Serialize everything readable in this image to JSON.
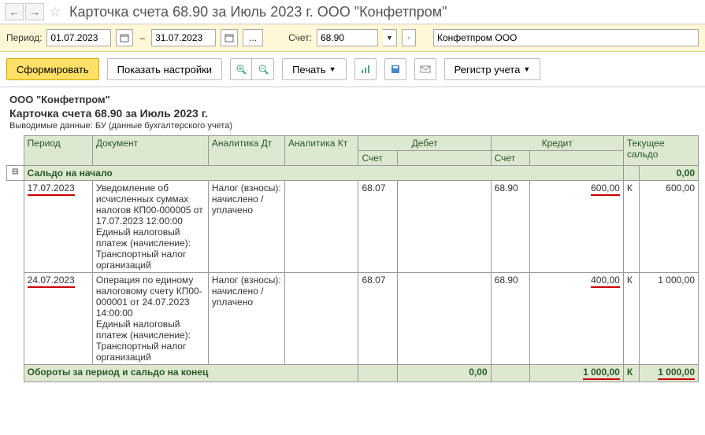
{
  "nav": {
    "back": "←",
    "fwd": "→",
    "star": "☆"
  },
  "title": "Карточка счета 68.90 за Июль 2023 г. ООО \"Конфетпром\"",
  "filter": {
    "period_label": "Период:",
    "date_from": "01.07.2023",
    "date_to": "31.07.2023",
    "dash": "–",
    "dots": "...",
    "account_label": "Счет:",
    "account": "68.90",
    "org": "Конфетпром ООО"
  },
  "actions": {
    "form": "Сформировать",
    "settings": "Показать настройки",
    "print": "Печать",
    "register": "Регистр учета"
  },
  "report": {
    "org": "ООО \"Конфетпром\"",
    "title": "Карточка счета 68.90 за Июль 2023 г.",
    "sub": "Выводимые данные: БУ (данные бухгалтерского учета)"
  },
  "headers": {
    "period": "Период",
    "doc": "Документ",
    "anadt": "Аналитика Дт",
    "anakt": "Аналитика Кт",
    "debit": "Дебет",
    "credit": "Кредит",
    "balance": "Текущее сальдо",
    "acct": "Счет"
  },
  "rows": {
    "saldo_start": "Сальдо на начало",
    "saldo_start_val": "0,00",
    "r1": {
      "period": "17.07.2023",
      "doc": "Уведомление об исчисленных суммах налогов КП00-000005 от 17.07.2023 12:00:00\nЕдиный налоговый платеж (начисление): Транспортный налог организаций",
      "anadt": "Налог (взносы): начислено / уплачено",
      "d_acct": "68.07",
      "c_acct": "68.90",
      "c_amt": "600,00",
      "k": "К",
      "bal": "600,00"
    },
    "r2": {
      "period": "24.07.2023",
      "doc": "Операция по единому налоговому счету КП00-000001 от 24.07.2023 14:00:00\nЕдиный налоговый платеж (начисление): Транспортный налог организаций",
      "anadt": "Налог (взносы): начислено / уплачено",
      "d_acct": "68.07",
      "c_acct": "68.90",
      "c_amt": "400,00",
      "k": "К",
      "bal": "1 000,00"
    },
    "turnover": "Обороты за период и сальдо на конец",
    "t_debit": "0,00",
    "t_credit": "1 000,00",
    "t_k": "К",
    "t_bal": "1 000,00"
  }
}
